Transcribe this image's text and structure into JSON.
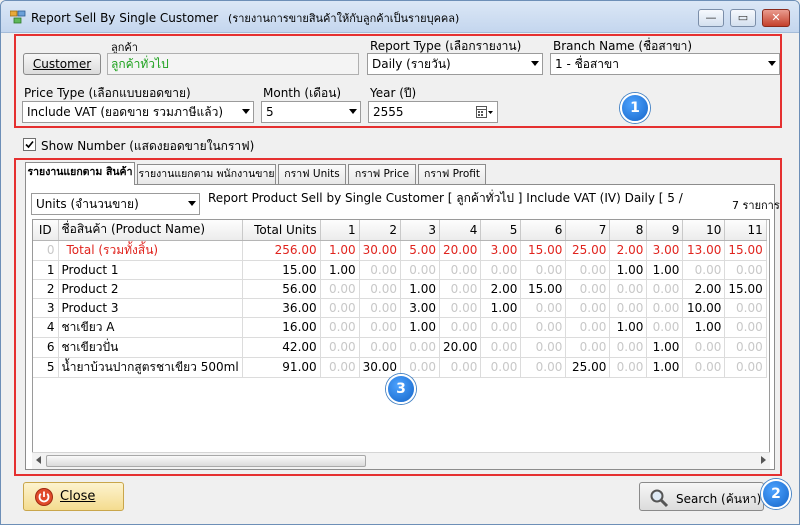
{
  "window": {
    "title": "Report Sell By Single Customer",
    "title_thai": "(รายงานการขายสินค้าให้กับลูกค้าเป็นรายบุคคล)",
    "minimize": "—",
    "maximize": "▭",
    "close": "✕"
  },
  "filters": {
    "customer_caption": "ลูกค้า",
    "customer_button": "Customer",
    "customer_value": "ลูกค้าทั่วไป",
    "report_type_label": "Report Type (เลือกรายงาน)",
    "report_type_value": "Daily (รายวัน)",
    "branch_label": "Branch Name (ชื่อสาขา)",
    "branch_value": "1 - ชื่อสาขา",
    "price_type_label": "Price Type (เลือกแบบยอดขาย)",
    "price_type_value": "Include VAT (ยอดขาย รวมภาษีแล้ว)",
    "month_label": "Month (เดือน)",
    "month_value": "5",
    "year_label": "Year (ปี)",
    "year_value": "2555"
  },
  "show_number": {
    "label": "Show Number (แสดงยอดขายในกราฟ)",
    "checked": true
  },
  "tabs": [
    {
      "label": "รายงานแยกตาม สินค้า",
      "active": true
    },
    {
      "label": "รายงานแยกตาม พนักงานขาย",
      "active": false
    },
    {
      "label": "กราฟ Units",
      "active": false
    },
    {
      "label": "กราฟ Price",
      "active": false
    },
    {
      "label": "กราฟ Profit",
      "active": false
    }
  ],
  "report": {
    "units_select": "Units (จำนวนขาย)",
    "header_text": "Report Product Sell by Single Customer [ ลูกค้าทั่วไป ] Include VAT (IV) Daily [ 5 /",
    "item_count": "7 รายการ"
  },
  "grid": {
    "columns": [
      "ID",
      "ชื่อสินค้า (Product Name)",
      "Total Units",
      "1",
      "2",
      "3",
      "4",
      "5",
      "6",
      "7",
      "8",
      "9",
      "10",
      "11"
    ],
    "rows": [
      {
        "id": "0",
        "name": "Total (รวมทั้งสิ้น)",
        "total": "256.00",
        "days": [
          "1.00",
          "30.00",
          "5.00",
          "20.00",
          "3.00",
          "15.00",
          "25.00",
          "2.00",
          "3.00",
          "13.00",
          "15.00"
        ],
        "is_total": true
      },
      {
        "id": "1",
        "name": "Product 1",
        "total": "15.00",
        "days": [
          "1.00",
          "0.00",
          "0.00",
          "0.00",
          "0.00",
          "0.00",
          "0.00",
          "1.00",
          "1.00",
          "0.00",
          "0.00"
        ],
        "is_total": false
      },
      {
        "id": "2",
        "name": "Product 2",
        "total": "56.00",
        "days": [
          "0.00",
          "0.00",
          "1.00",
          "0.00",
          "2.00",
          "15.00",
          "0.00",
          "0.00",
          "0.00",
          "2.00",
          "15.00"
        ],
        "is_total": false
      },
      {
        "id": "3",
        "name": "Product 3",
        "total": "36.00",
        "days": [
          "0.00",
          "0.00",
          "3.00",
          "0.00",
          "1.00",
          "0.00",
          "0.00",
          "0.00",
          "0.00",
          "10.00",
          "0.00"
        ],
        "is_total": false
      },
      {
        "id": "4",
        "name": "ชาเขียว A",
        "total": "16.00",
        "days": [
          "0.00",
          "0.00",
          "1.00",
          "0.00",
          "0.00",
          "0.00",
          "0.00",
          "1.00",
          "0.00",
          "1.00",
          "0.00"
        ],
        "is_total": false
      },
      {
        "id": "6",
        "name": "ชาเขียวปั่น",
        "total": "42.00",
        "days": [
          "0.00",
          "0.00",
          "0.00",
          "20.00",
          "0.00",
          "0.00",
          "0.00",
          "0.00",
          "1.00",
          "0.00",
          "0.00"
        ],
        "is_total": false
      },
      {
        "id": "5",
        "name": "น้ำยาบ้วนปากสูตรชาเขียว 500ml",
        "total": "91.00",
        "days": [
          "0.00",
          "30.00",
          "0.00",
          "0.00",
          "0.00",
          "0.00",
          "25.00",
          "0.00",
          "1.00",
          "0.00",
          "0.00"
        ],
        "is_total": false
      }
    ]
  },
  "buttons": {
    "close": "Close",
    "search": "Search (ค้นหา)"
  },
  "annotations": [
    "1",
    "2",
    "3"
  ],
  "colors": {
    "highlight_box": "#e53030",
    "total_row_text": "#e0241e",
    "badge": "#1565c8"
  }
}
